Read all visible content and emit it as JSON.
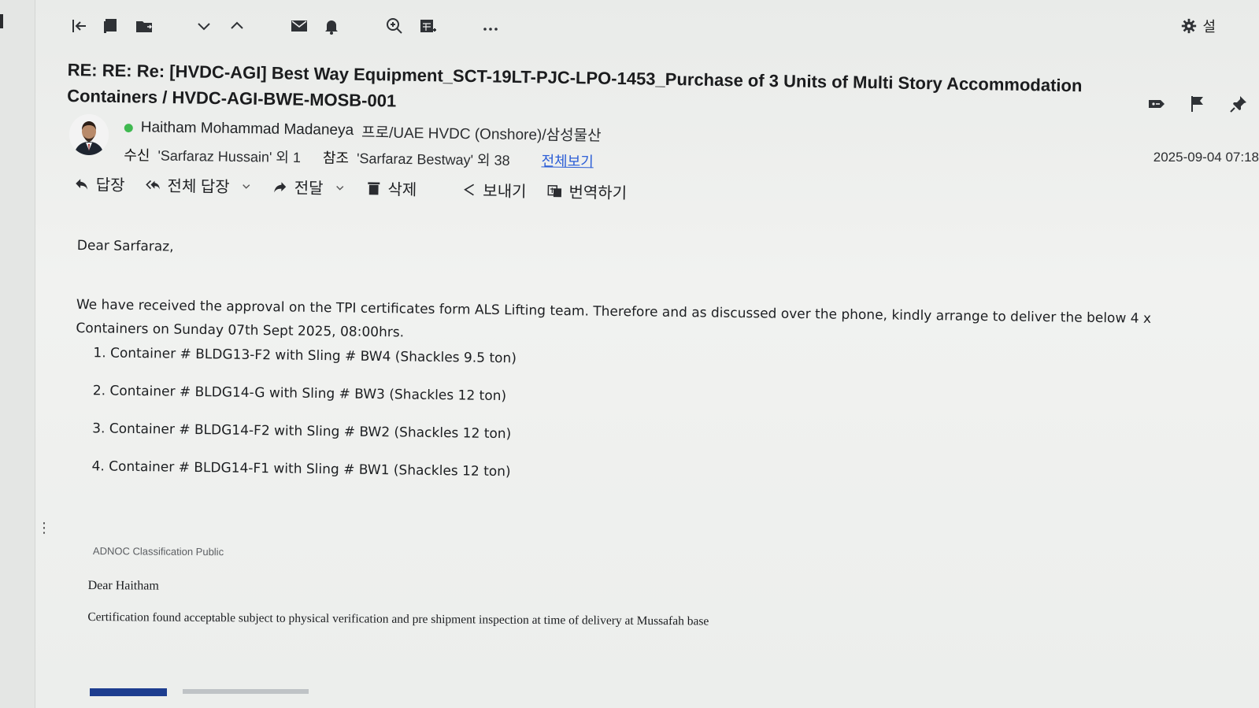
{
  "toolbar": {
    "icons": [
      "back-to-list-icon",
      "archive-icon",
      "move-folder-icon",
      "chevron-down-icon",
      "chevron-up-icon",
      "mail-icon",
      "bell-icon",
      "zoom-icon",
      "calendar-add-icon",
      "more-icon"
    ],
    "settings_label": "설"
  },
  "email": {
    "subject": "RE: RE: Re: [HVDC-AGI] Best Way Equipment_SCT-19LT-PJC-LPO-1453_Purchase of 3 Units of Multi Story Accommodation Containers / HVDC-AGI-BWE-MOSB-001",
    "sender": {
      "name": "Haitham Mohammad Madaneya",
      "org": "프로/UAE HVDC (Onshore)/삼성물산",
      "presence_color": "#3fb950"
    },
    "to_label": "수신",
    "to_value": "'Sarfaraz Hussain' 외 1",
    "cc_label": "참조",
    "cc_value": "'Sarfaraz Bestway' 외 38",
    "view_all": "전체보기",
    "timestamp": "2025-09-04 07:18"
  },
  "actions": {
    "reply": "답장",
    "reply_all": "전체 답장",
    "forward": "전달",
    "delete": "삭제",
    "send": "보내기",
    "translate": "번역하기"
  },
  "body": {
    "greeting": "Dear Sarfaraz,",
    "paragraph": "We have received the approval on the TPI certificates form ALS Lifting team. Therefore and as discussed over the phone, kindly arrange to deliver the below 4 x Containers on Sunday 07th Sept 2025, 08:00hrs.",
    "containers": [
      "Container # BLDG13-F2 with Sling # BW4 (Shackles 9.5 ton)",
      "Container # BLDG14-G with Sling # BW3 (Shackles 12 ton)",
      "Container # BLDG14-F2 with Sling # BW2 (Shackles 12 ton)",
      "Container # BLDG14-F1 with Sling # BW1 (Shackles 12 ton)"
    ],
    "quoted": {
      "classification": "ADNOC Classification  Public",
      "greeting": "Dear Haitham",
      "text": "Certification found acceptable subject to physical verification and pre shipment inspection  at time of delivery at Mussafah base"
    }
  },
  "colors": {
    "link": "#2c5ed6",
    "accent_bar": "#1d3d8f"
  }
}
